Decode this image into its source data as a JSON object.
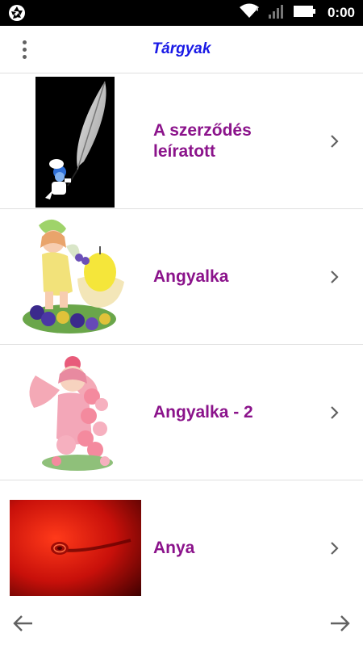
{
  "status_bar": {
    "time": "0:00",
    "icons": [
      "aperture-icon",
      "wifi-icon",
      "signal-icon",
      "battery-icon"
    ]
  },
  "app_bar": {
    "title": "Tárgyak",
    "menu_icon": "more-vertical-icon"
  },
  "items": [
    {
      "label": "A szerződés leíratott",
      "image": "feather-quill-smurf-image"
    },
    {
      "label": "Angyalka",
      "image": "fairy-candle-figurine-image"
    },
    {
      "label": "Angyalka - 2",
      "image": "pink-fairy-figurine-image"
    },
    {
      "label": "Anya",
      "image": "red-swirl-image"
    }
  ],
  "bottom_nav": {
    "back_icon": "arrow-left-icon",
    "forward_icon": "arrow-right-icon"
  },
  "colors": {
    "title": "#1a1ae6",
    "item_label": "#8b138b",
    "divider": "#e0e0e0"
  }
}
